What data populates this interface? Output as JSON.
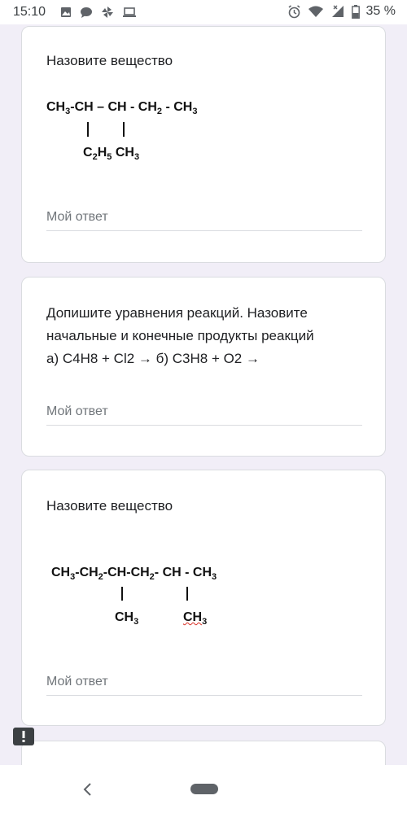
{
  "status_bar": {
    "time": "15:10",
    "battery": "35 %",
    "icons": [
      "image-icon",
      "chat-icon",
      "pinwheel-icon",
      "laptop-icon",
      "alarm-icon",
      "wifi-icon",
      "signal-icon",
      "battery-icon"
    ]
  },
  "questions": [
    {
      "title": "Назовите вещество",
      "formula_main": "CH3-CH – CH - CH2 - CH3",
      "formula_branch_1": "C2H5",
      "formula_branch_2": "CH3",
      "answer_placeholder": "Мой ответ"
    },
    {
      "title_line1": "Допишите уравнения реакций. Назовите",
      "title_line2": "начальные и конечные продукты реакций",
      "title_line3": "а) C4H8 + Cl2 → б) C3H8 + O2 →",
      "answer_placeholder": "Мой ответ"
    },
    {
      "title": "Назовите вещество",
      "formula_main": "CH3-CH2-CH-CH2- CH - CH3",
      "formula_branch_1": "CH3",
      "formula_branch_2": "CH3",
      "answer_placeholder": "Мой ответ"
    }
  ],
  "colors": {
    "background": "#f1eef7",
    "card": "#ffffff",
    "placeholder": "#70757a"
  }
}
